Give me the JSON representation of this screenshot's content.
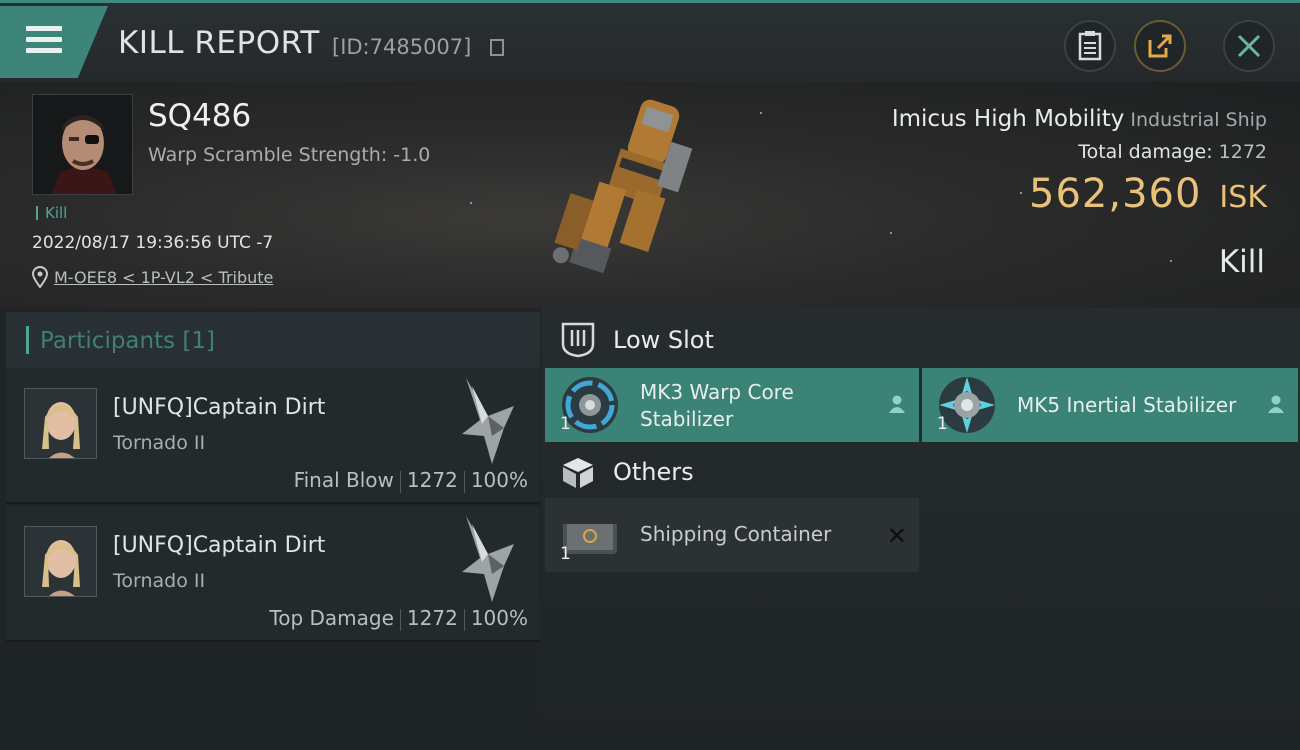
{
  "header": {
    "title": "KILL REPORT",
    "report_id": "[ID:7485007]"
  },
  "victim": {
    "pilot_name": "SQ486",
    "warp_scramble": "Warp Scramble Strength: -1.0",
    "tag": "Kill",
    "datetime": "2022/08/17 19:36:56 UTC -7",
    "location": "M-OEE8 < 1P-VL2 < Tribute",
    "ship_name": "Imicus High Mobility",
    "ship_class": "Industrial Ship",
    "total_damage_label": "Total damage:",
    "total_damage": "1272",
    "isk_value": "562,360",
    "isk_unit": "ISK",
    "result": "Kill"
  },
  "participants": {
    "header": "Participants [1]",
    "rows": [
      {
        "name": "[UNFQ]Captain Dirt",
        "ship": "Tornado II",
        "role": "Final Blow",
        "damage": "1272",
        "percent": "100%"
      },
      {
        "name": "[UNFQ]Captain Dirt",
        "ship": "Tornado II",
        "role": "Top Damage",
        "damage": "1272",
        "percent": "100%"
      }
    ]
  },
  "modules": {
    "low_slot_title": "Low Slot",
    "low_slot": [
      {
        "name": "MK3 Warp Core Stabilizer",
        "qty": "1"
      },
      {
        "name": "MK5 Inertial Stabilizer",
        "qty": "1"
      }
    ],
    "others_title": "Others",
    "others": [
      {
        "name": "Shipping Container",
        "qty": "1"
      }
    ]
  },
  "colors": {
    "accent_teal": "#3b8376",
    "isk_gold": "#e9c27a",
    "background": "#1e2325"
  }
}
